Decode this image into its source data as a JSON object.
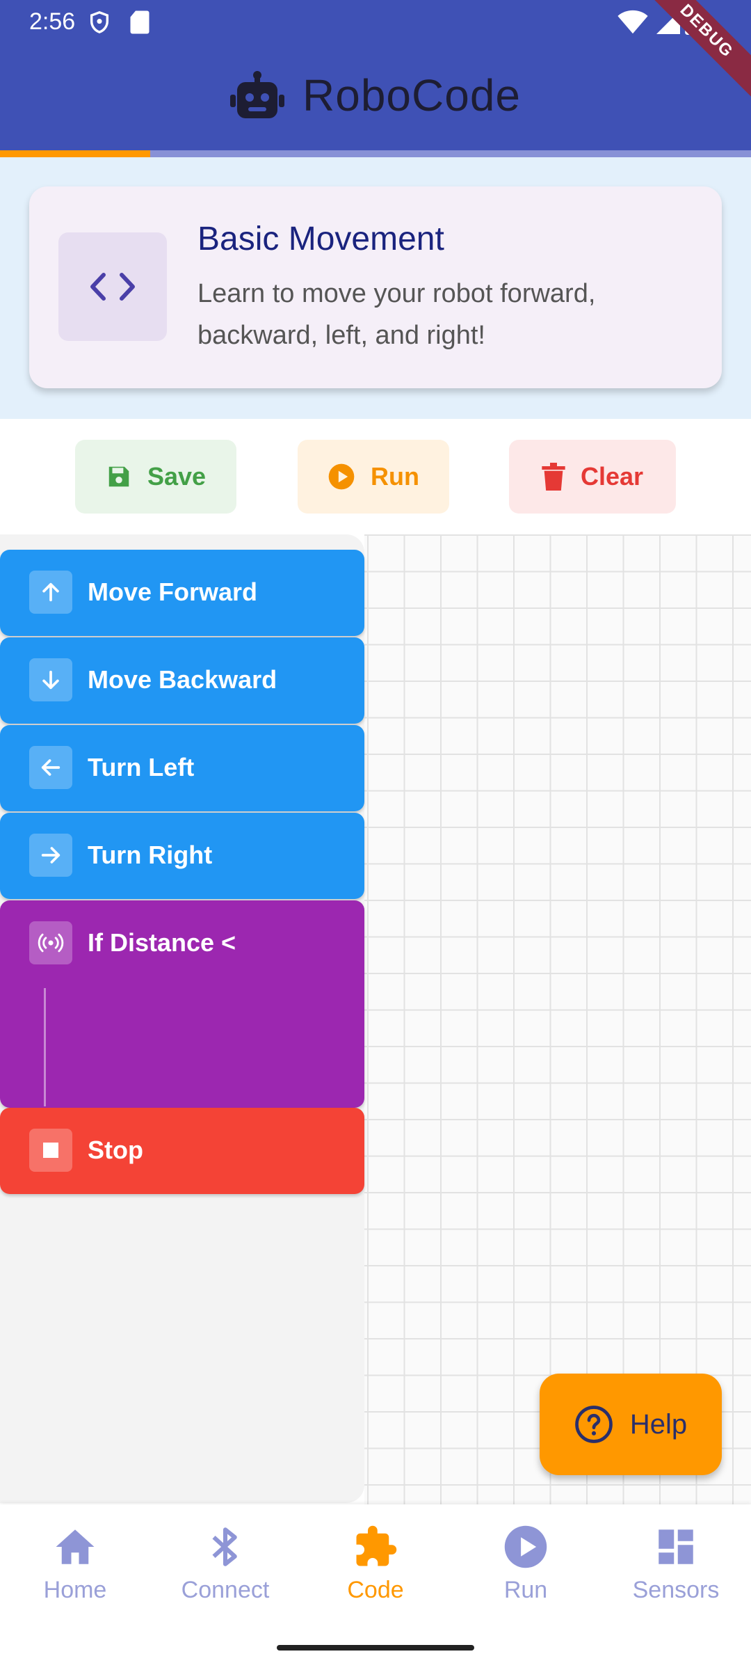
{
  "status": {
    "time": "2:56"
  },
  "app": {
    "title": "RoboCode",
    "debug_label": "DEBUG",
    "progress": 0.2
  },
  "lesson": {
    "title": "Basic Movement",
    "description": "Learn to move your robot forward, backward, left, and right!"
  },
  "toolbar": {
    "save_label": "Save",
    "run_label": "Run",
    "clear_label": "Clear"
  },
  "blocks": [
    {
      "label": "Move Forward",
      "icon": "arrow-up-icon",
      "color": "#2196f3"
    },
    {
      "label": "Move Backward",
      "icon": "arrow-down-icon",
      "color": "#2196f3"
    },
    {
      "label": "Turn Left",
      "icon": "arrow-left-icon",
      "color": "#2196f3"
    },
    {
      "label": "Turn Right",
      "icon": "arrow-right-icon",
      "color": "#2196f3"
    },
    {
      "label": "If Distance <",
      "icon": "sensor-icon",
      "color": "#9c27b0"
    },
    {
      "label": "Stop",
      "icon": "stop-icon",
      "color": "#f44336"
    }
  ],
  "help": {
    "label": "Help"
  },
  "nav": {
    "items": [
      {
        "label": "Home",
        "icon": "home-icon"
      },
      {
        "label": "Connect",
        "icon": "bluetooth-icon"
      },
      {
        "label": "Code",
        "icon": "puzzle-icon",
        "active": true
      },
      {
        "label": "Run",
        "icon": "play-circle-icon"
      },
      {
        "label": "Sensors",
        "icon": "dashboard-icon"
      }
    ]
  },
  "colors": {
    "primary": "#3f51b5",
    "accent": "#ff9800"
  }
}
